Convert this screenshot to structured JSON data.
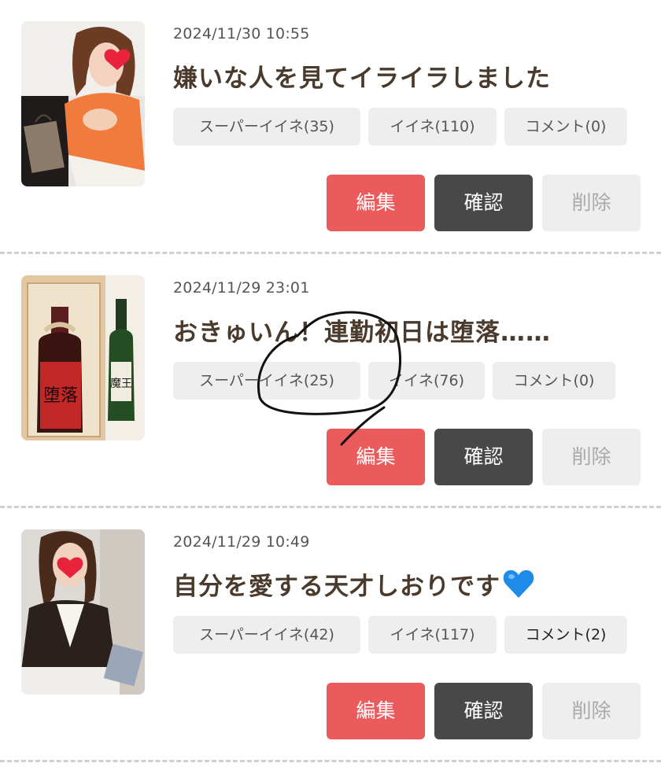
{
  "posts": [
    {
      "date": "2024/11/30 10:55",
      "title": "嫌いな人を見てイライラしました",
      "super_like": "スーパーイイネ(35)",
      "like": "イイネ(110)",
      "comment": "コメント(0)",
      "edit": "編集",
      "confirm": "確認",
      "delete": "削除"
    },
    {
      "date": "2024/11/29 23:01",
      "title": "おきゅいん！連勤初日は堕落……",
      "super_like": "スーパーイイネ(25)",
      "like": "イイネ(76)",
      "comment": "コメント(0)",
      "edit": "編集",
      "confirm": "確認",
      "delete": "削除"
    },
    {
      "date": "2024/11/29 10:49",
      "title": "自分を愛する天才しおりです",
      "title_emoji": "blue-heart",
      "super_like": "スーパーイイネ(42)",
      "like": "イイネ(117)",
      "comment": "コメント(2)",
      "edit": "編集",
      "confirm": "確認",
      "delete": "削除"
    }
  ],
  "thumbnail_texts": {
    "bottle_label": "堕落",
    "sake_label": "魔王"
  },
  "colors": {
    "edit_button": "#ec5b5b",
    "confirm_button": "#484848",
    "delete_button": "#eeeeee",
    "badge": "#eeeeee",
    "title_text": "#4a3a2c"
  }
}
